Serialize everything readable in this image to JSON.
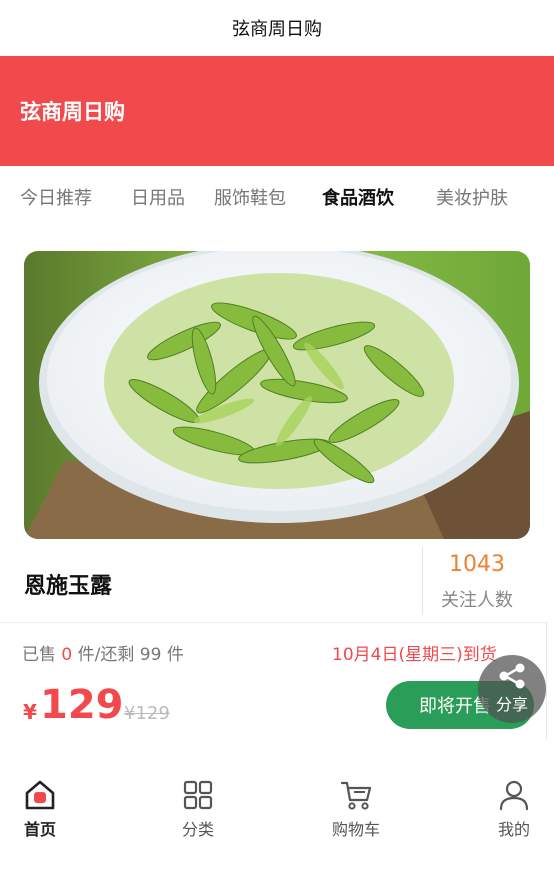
{
  "status_bar": {
    "title": "弦商周日购"
  },
  "header": {
    "title": "弦商周日购",
    "banner_color": "#f2494c"
  },
  "tabs": [
    {
      "label": "今日推荐",
      "active": false
    },
    {
      "label": "日用品",
      "active": false
    },
    {
      "label": "服饰鞋包",
      "active": false
    },
    {
      "label": "食品酒饮",
      "active": true
    },
    {
      "label": "美妆护肤",
      "active": false
    }
  ],
  "product": {
    "name": "恩施玉露",
    "image": "green-tea-leaves-in-white-bowl",
    "follow_count": "1043",
    "follow_label": "关注人数",
    "sold_prefix": "已售",
    "sold_count": "0",
    "sold_mid": "件/还剩",
    "remaining": "99",
    "sold_suffix": "件",
    "arrival": "10月4日(星期三)到货",
    "currency_symbol": "¥",
    "price": "129",
    "original_price": "¥129",
    "cta_label": "即将开售",
    "accent_color": "#f2494c",
    "cta_color": "#2a9d58"
  },
  "share": {
    "label": "分享",
    "icon": "share-icon"
  },
  "bottom_nav": [
    {
      "label": "首页",
      "icon": "home-icon",
      "active": true
    },
    {
      "label": "分类",
      "icon": "category-icon",
      "active": false
    },
    {
      "label": "购物车",
      "icon": "cart-icon",
      "active": false
    },
    {
      "label": "我的",
      "icon": "user-icon",
      "active": false
    }
  ]
}
